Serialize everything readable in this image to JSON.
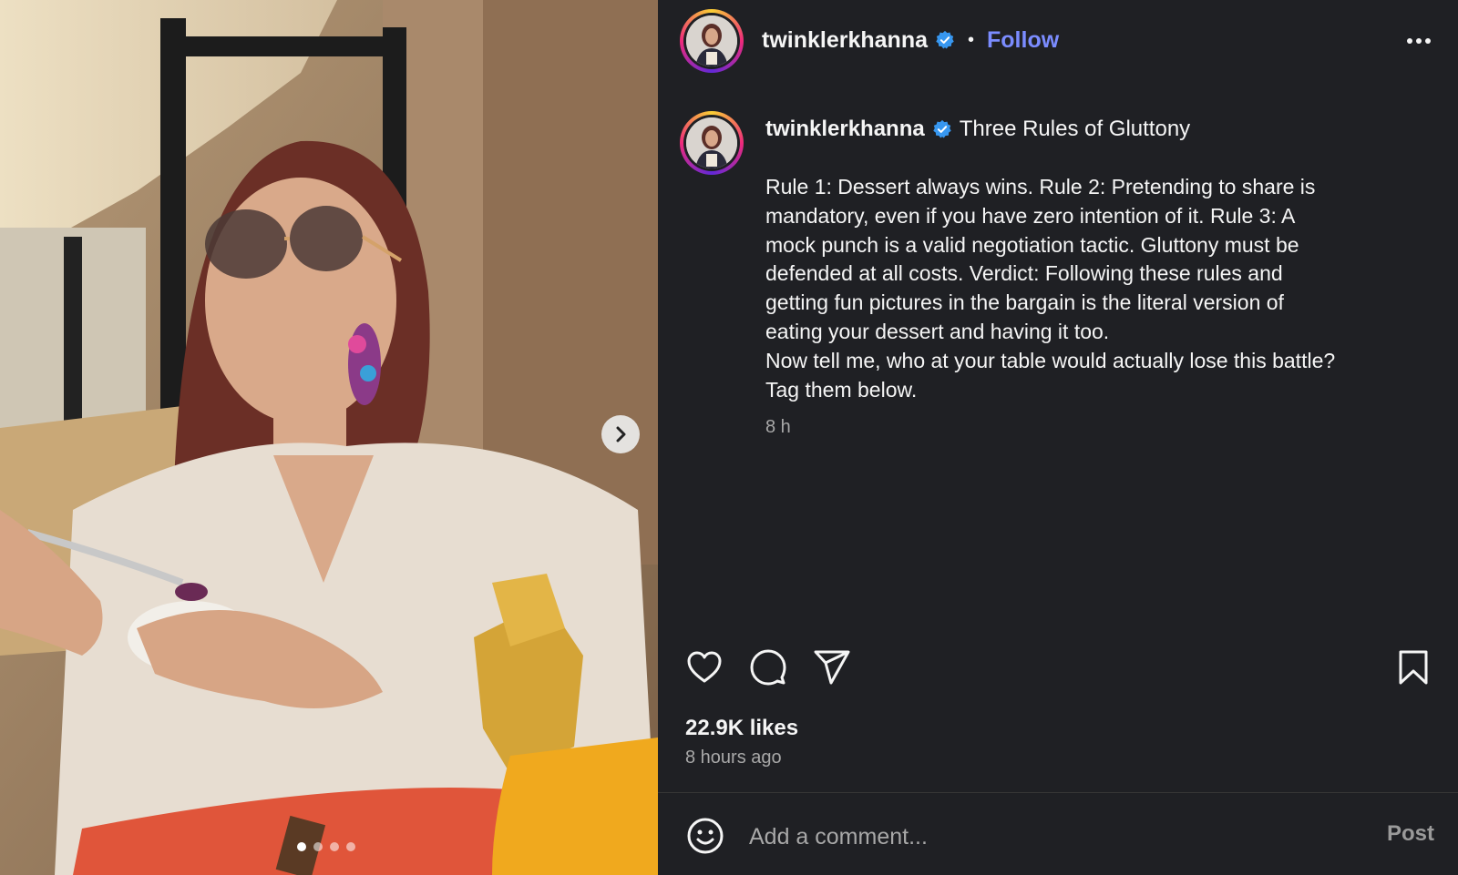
{
  "post": {
    "username": "twinklerkhanna",
    "separator": "•",
    "follow_label": "Follow",
    "caption_title": "Three Rules of Gluttony",
    "caption_lines": [
      "Rule 1: Dessert always wins. Rule 2: Pretending to share is",
      "mandatory, even if you have zero intention of it. Rule 3: A",
      "mock punch is a valid negotiation tactic. Gluttony must be",
      "defended at all costs. Verdict: Following these rules and",
      "getting fun pictures in the bargain is the literal version of",
      "eating your dessert and having it too.",
      "Now tell me, who at your table would actually lose this battle?",
      "Tag them below."
    ],
    "caption_time": "8 h",
    "likes": "22.9K likes",
    "time_ago": "8 hours ago",
    "carousel_count": 4,
    "carousel_active": 1
  },
  "comment": {
    "placeholder": "Add a comment...",
    "post_label": "Post"
  },
  "colors": {
    "panel_bg": "#1f2024",
    "follow": "#7b8cff",
    "verified": "#3797f0",
    "muted": "#a8a8a8"
  },
  "icons": [
    "heart-icon",
    "comment-icon",
    "share-icon",
    "bookmark-icon",
    "more-icon",
    "emoji-icon",
    "chevron-right-icon",
    "verified-icon"
  ]
}
